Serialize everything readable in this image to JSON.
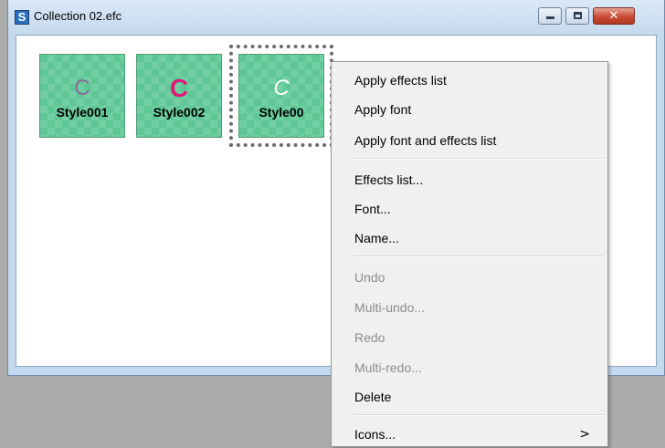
{
  "window": {
    "title": "Collection 02.efc",
    "app_icon_letter": "S",
    "controls": {
      "minimize": "",
      "maximize": "",
      "close": "✕"
    }
  },
  "styles": [
    {
      "name": "Style001",
      "glyph": "C",
      "glyph_color": "#8b6a9a"
    },
    {
      "name": "Style002",
      "glyph": "C",
      "glyph_color": "#e0187a"
    },
    {
      "name": "Style00",
      "glyph": "C",
      "glyph_color": "#ffffff",
      "selected": true
    }
  ],
  "context_menu": {
    "items": [
      {
        "label": "Apply effects list",
        "enabled": true
      },
      {
        "label": "Apply font",
        "enabled": true
      },
      {
        "label": "Apply font and effects list",
        "enabled": true
      },
      {
        "label": "Effects list...",
        "enabled": true
      },
      {
        "label": "Font...",
        "enabled": true
      },
      {
        "label": "Name...",
        "enabled": true
      },
      {
        "label": "Undo",
        "enabled": false
      },
      {
        "label": "Multi-undo...",
        "enabled": false
      },
      {
        "label": "Redo",
        "enabled": false
      },
      {
        "label": "Multi-redo...",
        "enabled": false
      },
      {
        "label": "Delete",
        "enabled": true
      },
      {
        "label": "Icons...",
        "enabled": true,
        "submenu_arrow": ">"
      }
    ]
  },
  "colors": {
    "tile_green": "#5fc796",
    "menu_bg": "#f0f0f0",
    "disabled_text": "#8d8d8d",
    "desktop_gray": "#ababab"
  }
}
